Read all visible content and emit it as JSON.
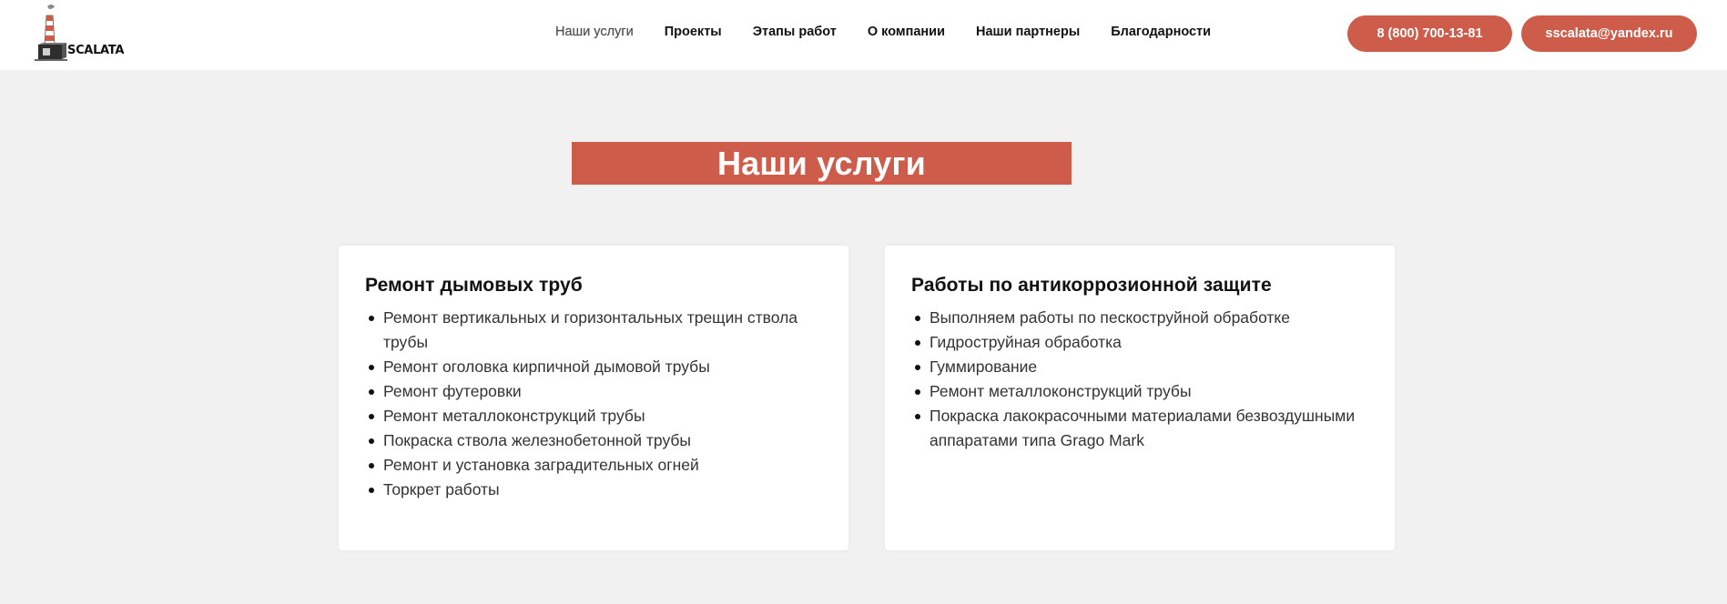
{
  "header": {
    "logo_text": "SCALATA",
    "nav": [
      {
        "label": "Наши услуги",
        "active": true
      },
      {
        "label": "Проекты",
        "active": false
      },
      {
        "label": "Этапы работ",
        "active": false
      },
      {
        "label": "О компании",
        "active": false
      },
      {
        "label": "Наши партнеры",
        "active": false
      },
      {
        "label": "Благодарности",
        "active": false
      }
    ],
    "phone_label": "8 (800) 700-13-81",
    "email_label": "sscalata@yandex.ru"
  },
  "colors": {
    "accent": "#cd5c4b",
    "background": "#f1f1f1",
    "card": "#ffffff"
  },
  "services": {
    "title": "Наши услуги",
    "cards": [
      {
        "title": "Ремонт дымовых труб",
        "items": [
          "Ремонт вертикальных и горизонтальных трещин ствола трубы",
          "Ремонт оголовка кирпичной дымовой трубы",
          "Ремонт футеровки",
          "Ремонт металлоконструкций трубы",
          "Покраска ствола железнобетонной трубы",
          "Ремонт и установка заградительных огней",
          "Торкрет работы"
        ]
      },
      {
        "title": "Работы по антикоррозионной защите",
        "items": [
          "Выполняем работы по пескоструйной обработке",
          "Гидроструйная обработка",
          "Гуммирование",
          "Ремонт металлоконструкций трубы",
          "Покраска лакокрасочными материалами безвоздушными аппаратами типа Grago Mark"
        ]
      }
    ]
  }
}
